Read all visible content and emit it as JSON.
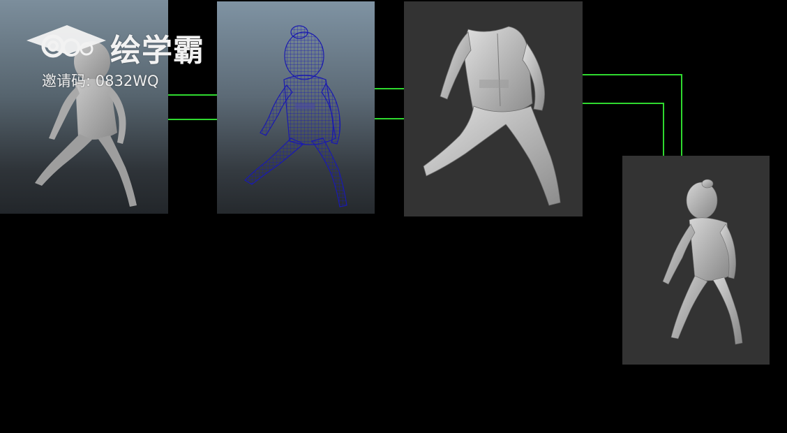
{
  "watermark": {
    "brand_name": "绘学霸",
    "invite_label": "邀请码: 0832WQ"
  },
  "colors": {
    "background": "#000000",
    "connector": "#2fd92f",
    "sculpt_bg": "#333333",
    "wireframe": "#1a1ab0"
  },
  "icons": {
    "logo": "graduation-cap-cloud-icon"
  }
}
